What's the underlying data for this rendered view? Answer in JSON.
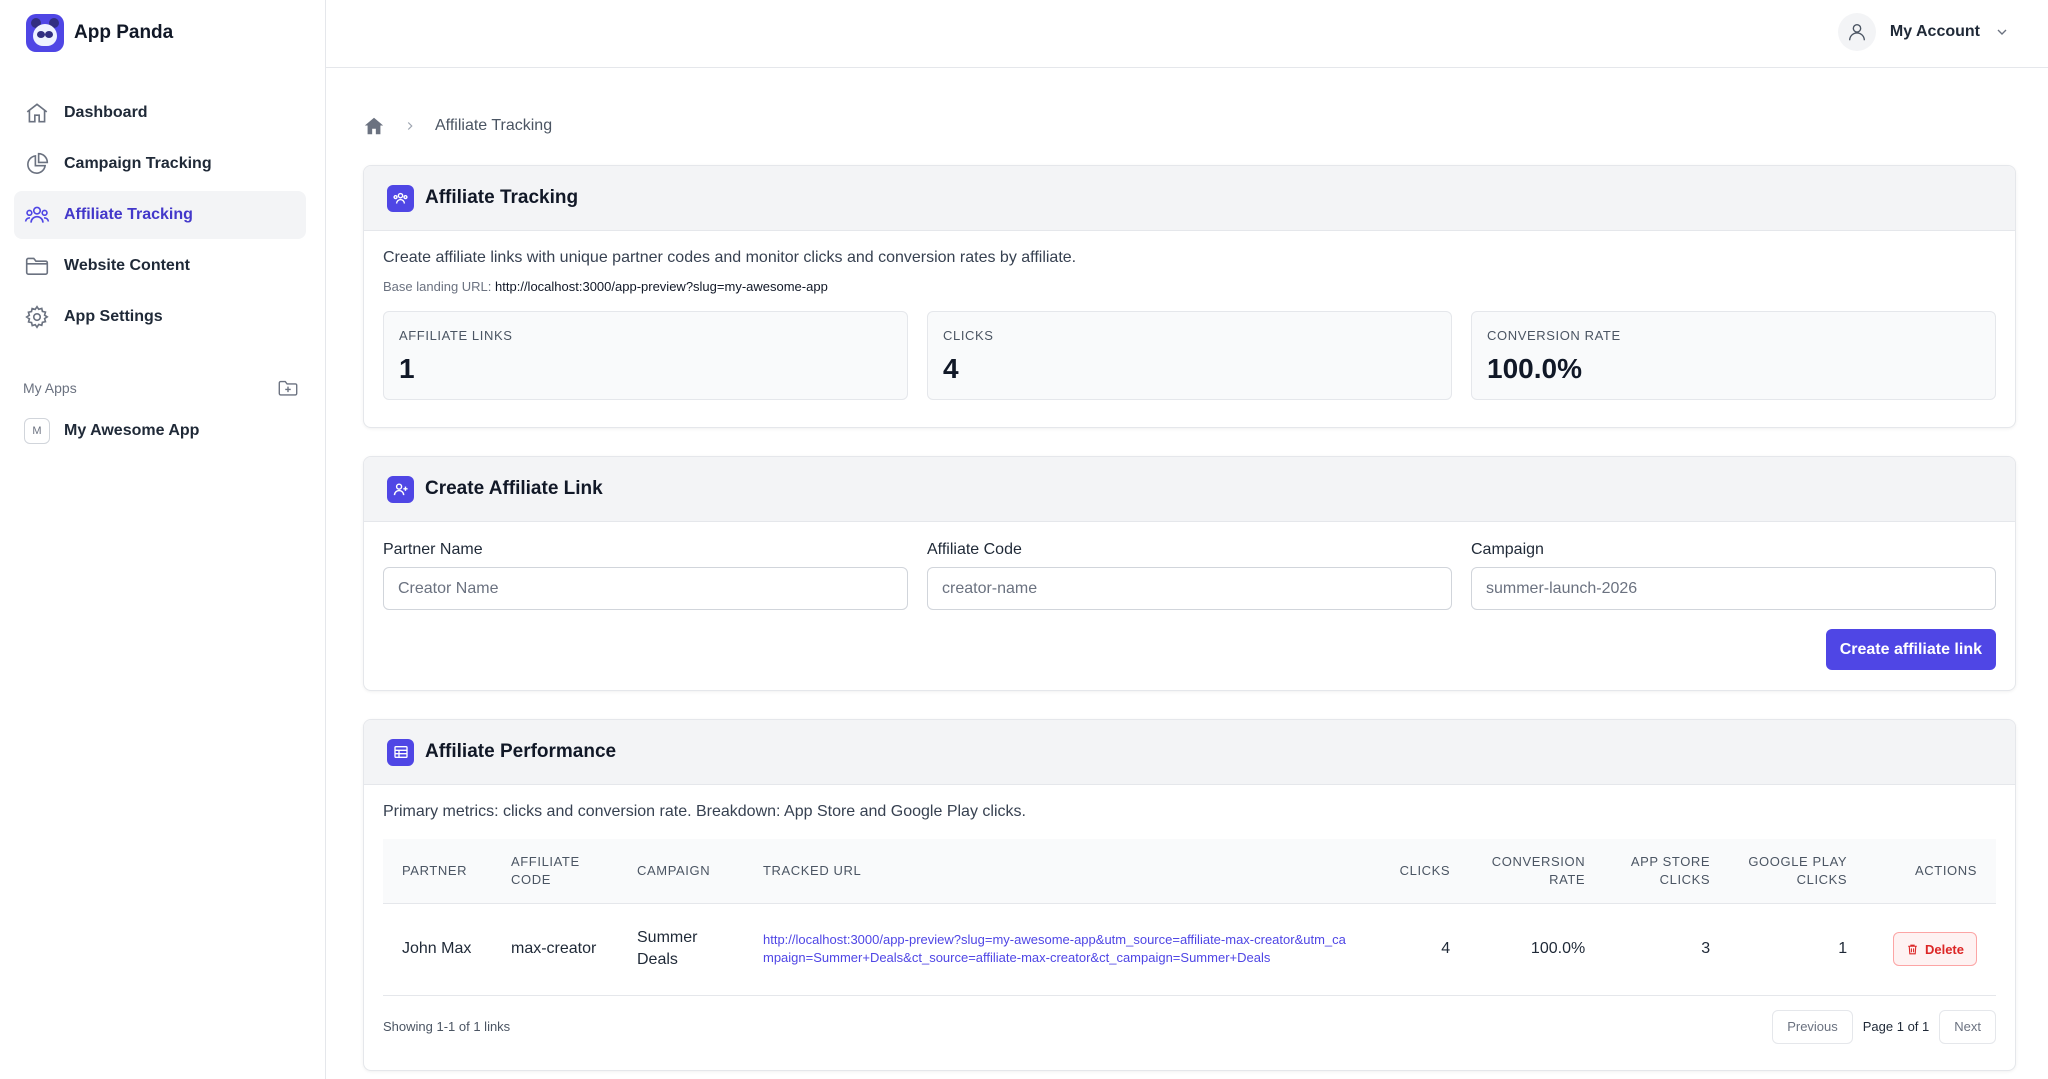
{
  "brand": {
    "name": "App Panda",
    "logo_icon": "panda-icon"
  },
  "sidebar": {
    "items": [
      {
        "label": "Dashboard",
        "icon": "home-icon"
      },
      {
        "label": "Campaign Tracking",
        "icon": "pie-chart-icon"
      },
      {
        "label": "Affiliate Tracking",
        "icon": "users-icon",
        "active": true
      },
      {
        "label": "Website Content",
        "icon": "folder-icon"
      },
      {
        "label": "App Settings",
        "icon": "gear-icon"
      }
    ],
    "apps_section_label": "My Apps",
    "apps": [
      {
        "initial": "M",
        "name": "My Awesome App"
      }
    ]
  },
  "header": {
    "account_label": "My Account"
  },
  "breadcrumb": {
    "current": "Affiliate Tracking"
  },
  "overview": {
    "title": "Affiliate Tracking",
    "description": "Create affiliate links with unique partner codes and monitor clicks and conversion rates by affiliate.",
    "base_url_label": "Base landing URL:",
    "base_url": "http://localhost:3000/app-preview?slug=my-awesome-app",
    "stats": [
      {
        "label": "AFFILIATE LINKS",
        "value": "1"
      },
      {
        "label": "CLICKS",
        "value": "4"
      },
      {
        "label": "CONVERSION RATE",
        "value": "100.0%"
      }
    ]
  },
  "create_form": {
    "title": "Create Affiliate Link",
    "fields": [
      {
        "label": "Partner Name",
        "placeholder": "Creator Name",
        "value": ""
      },
      {
        "label": "Affiliate Code",
        "placeholder": "creator-name",
        "value": ""
      },
      {
        "label": "Campaign",
        "placeholder": "summer-launch-2026",
        "value": ""
      }
    ],
    "submit_label": "Create affiliate link"
  },
  "performance": {
    "title": "Affiliate Performance",
    "description": "Primary metrics: clicks and conversion rate. Breakdown: App Store and Google Play clicks.",
    "columns": [
      "PARTNER",
      "AFFILIATE CODE",
      "CAMPAIGN",
      "TRACKED URL",
      "CLICKS",
      "CONVERSION RATE",
      "APP STORE CLICKS",
      "GOOGLE PLAY CLICKS",
      "ACTIONS"
    ],
    "rows": [
      {
        "partner": "John Max",
        "code": "max-creator",
        "campaign": "Summer Deals",
        "url": "http://localhost:3000/app-preview?slug=my-awesome-app&utm_source=affiliate-max-creator&utm_campaign=Summer+Deals&ct_source=affiliate-max-creator&ct_campaign=Summer+Deals",
        "clicks": "4",
        "conversion": "100.0%",
        "app_store": "3",
        "google_play": "1",
        "action_label": "Delete"
      }
    ],
    "showing": "Showing 1-1 of 1 links",
    "prev_label": "Previous",
    "page_label": "Page 1 of 1",
    "next_label": "Next"
  },
  "colors": {
    "accent": "#4f46e5",
    "danger": "#dc2626"
  }
}
